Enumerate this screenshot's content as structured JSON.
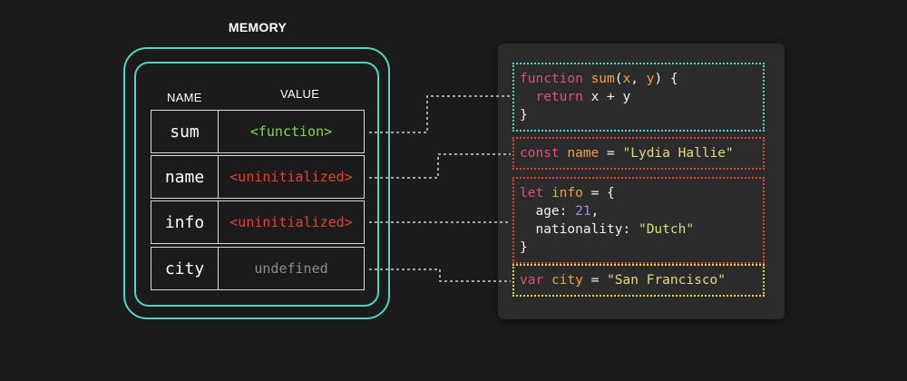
{
  "memory": {
    "title": "MEMORY",
    "col_name": "NAME",
    "col_value": "VALUE",
    "rows": [
      {
        "name": "sum",
        "value": "<function>",
        "color": "#7ed957"
      },
      {
        "name": "name",
        "value": "<uninitialized>",
        "color": "#e8413a"
      },
      {
        "name": "info",
        "value": "<uninitialized>",
        "color": "#e8413a"
      },
      {
        "name": "city",
        "value": "undefined",
        "color": "#8c8c8c"
      }
    ],
    "border_color": "#53d3c0"
  },
  "code": {
    "sum": {
      "kw": "function",
      "name": "sum",
      "p1": "x",
      "sep": ", ",
      "p2": "y",
      "ret_kw": "return",
      "ret_expr": "x + y",
      "border": "#53d3c0"
    },
    "name": {
      "kw": "const",
      "id": "name",
      "value": "\"Lydia Hallie\"",
      "border": "#e8413a"
    },
    "info": {
      "kw": "let",
      "id": "info",
      "k1": "age",
      "v1": "21",
      "k2": "nationality",
      "v2": "\"Dutch\"",
      "border": "#e8413a"
    },
    "city": {
      "kw": "var",
      "id": "city",
      "value": "\"San Francisco\"",
      "border": "#f0d23c"
    }
  }
}
